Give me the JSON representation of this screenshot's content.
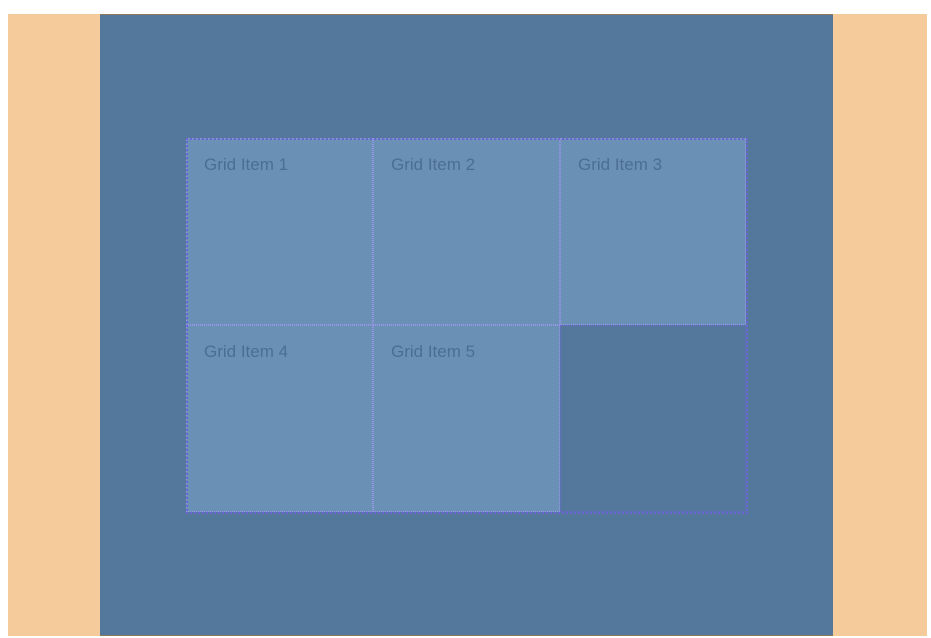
{
  "grid": {
    "items": [
      {
        "label": "Grid Item 1"
      },
      {
        "label": "Grid Item 2"
      },
      {
        "label": "Grid Item 3"
      },
      {
        "label": "Grid Item 4"
      },
      {
        "label": "Grid Item 5"
      }
    ]
  },
  "colors": {
    "page_margin": "#f6cb9c",
    "container_background": "#54789c",
    "grid_item_background": "#6b90b6",
    "grid_item_text": "#4b6e94",
    "grid_line_overlay": "#6a66d4"
  }
}
